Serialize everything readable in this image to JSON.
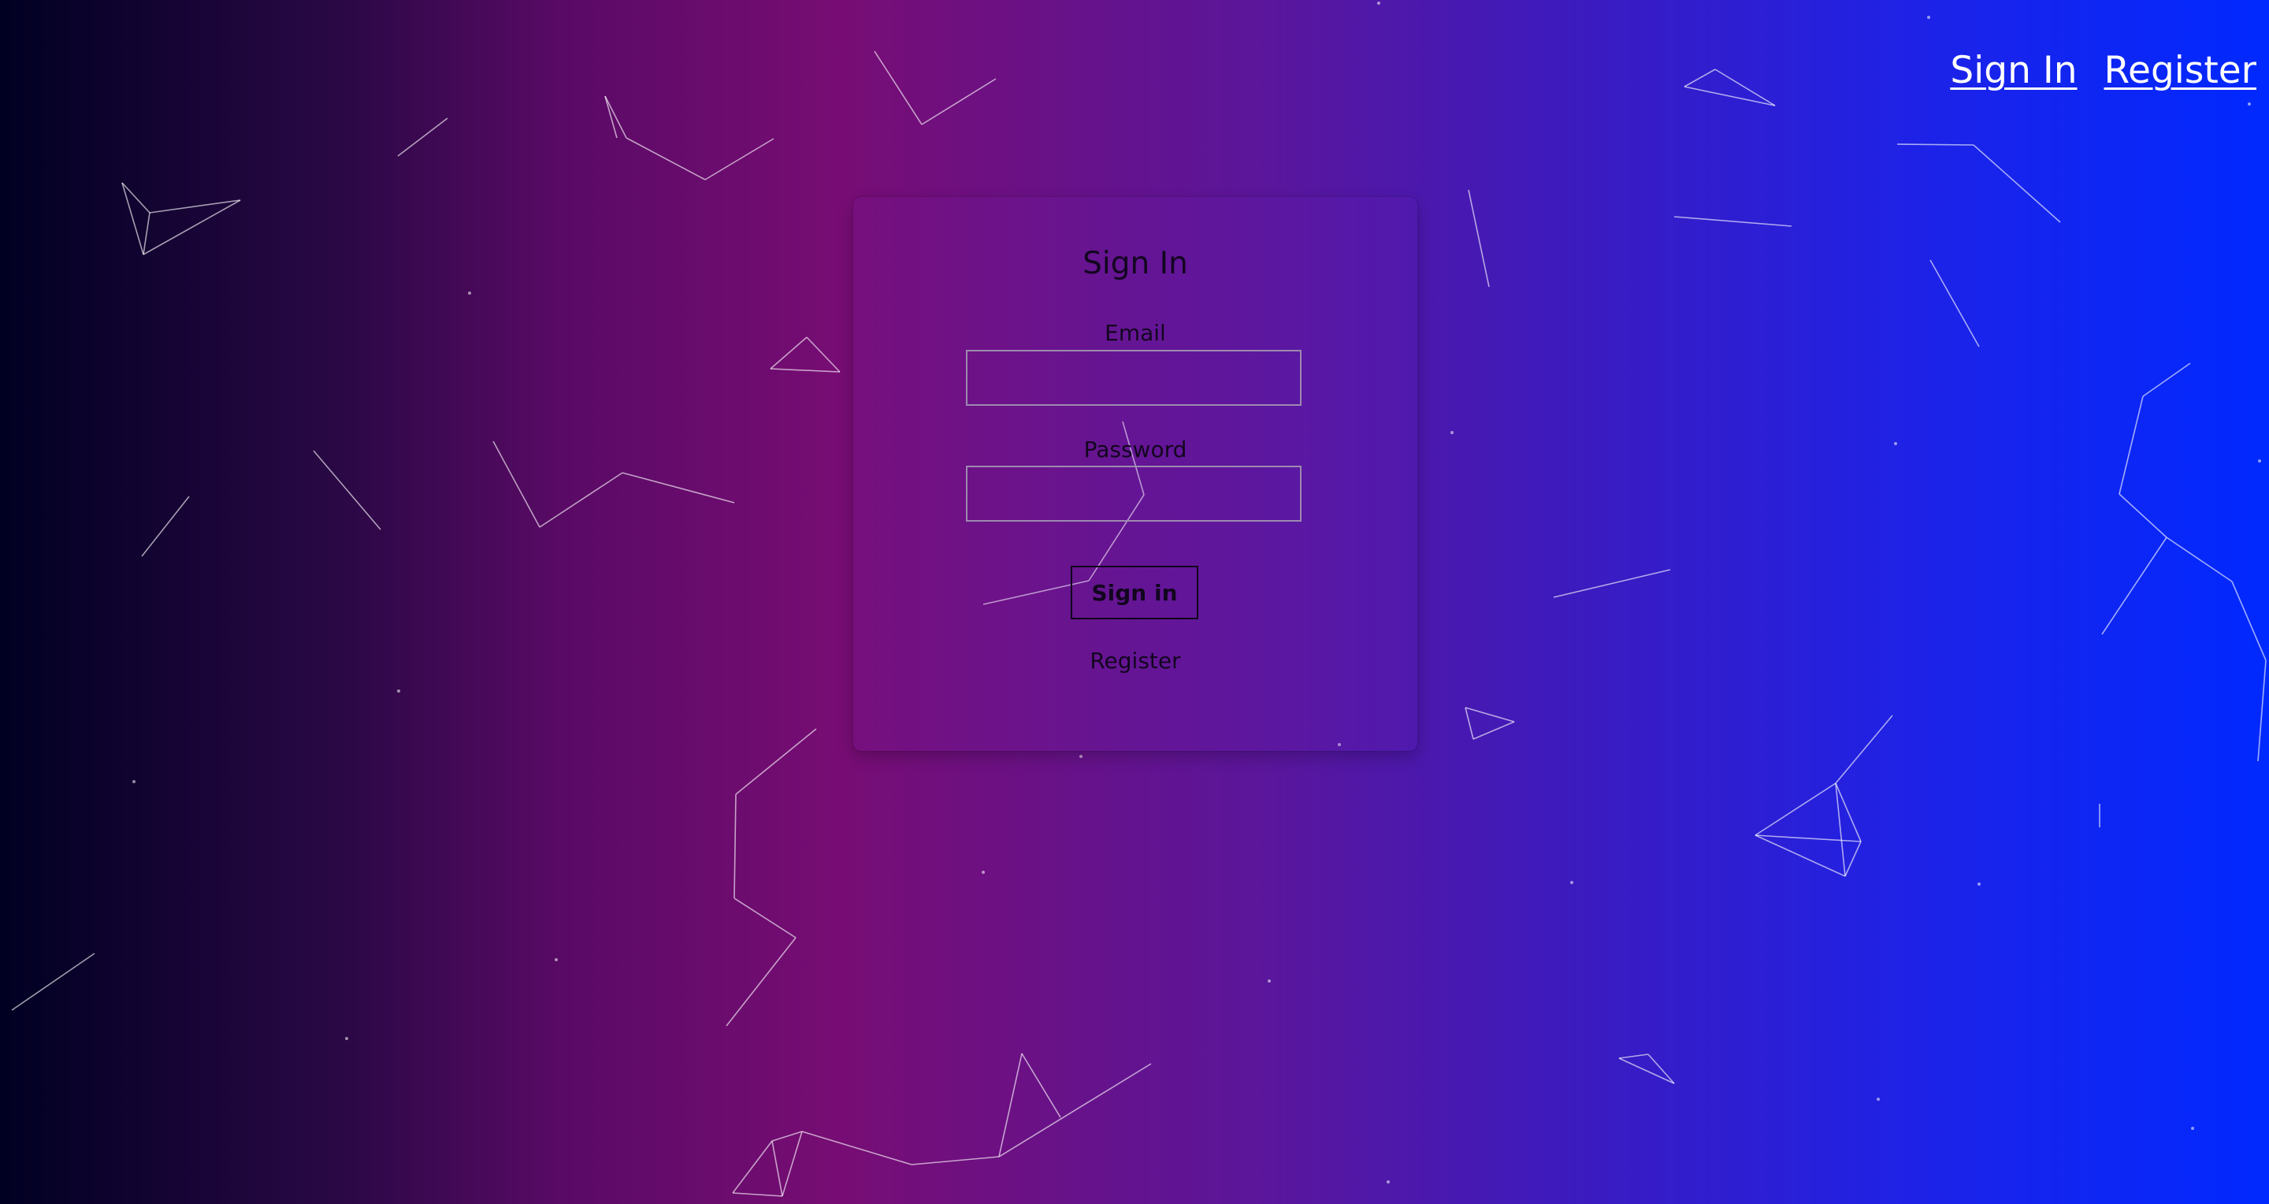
{
  "nav": {
    "sign_in": "Sign In",
    "register": "Register"
  },
  "form": {
    "title": "Sign In",
    "email_label": "Email",
    "email_value": "",
    "password_label": "Password",
    "password_value": "",
    "submit_label": "Sign in",
    "register_link": "Register"
  },
  "colors": {
    "gradient_start": "#000022",
    "gradient_mid": "#770d74",
    "gradient_end": "#0029ff",
    "text": "#12061f"
  }
}
